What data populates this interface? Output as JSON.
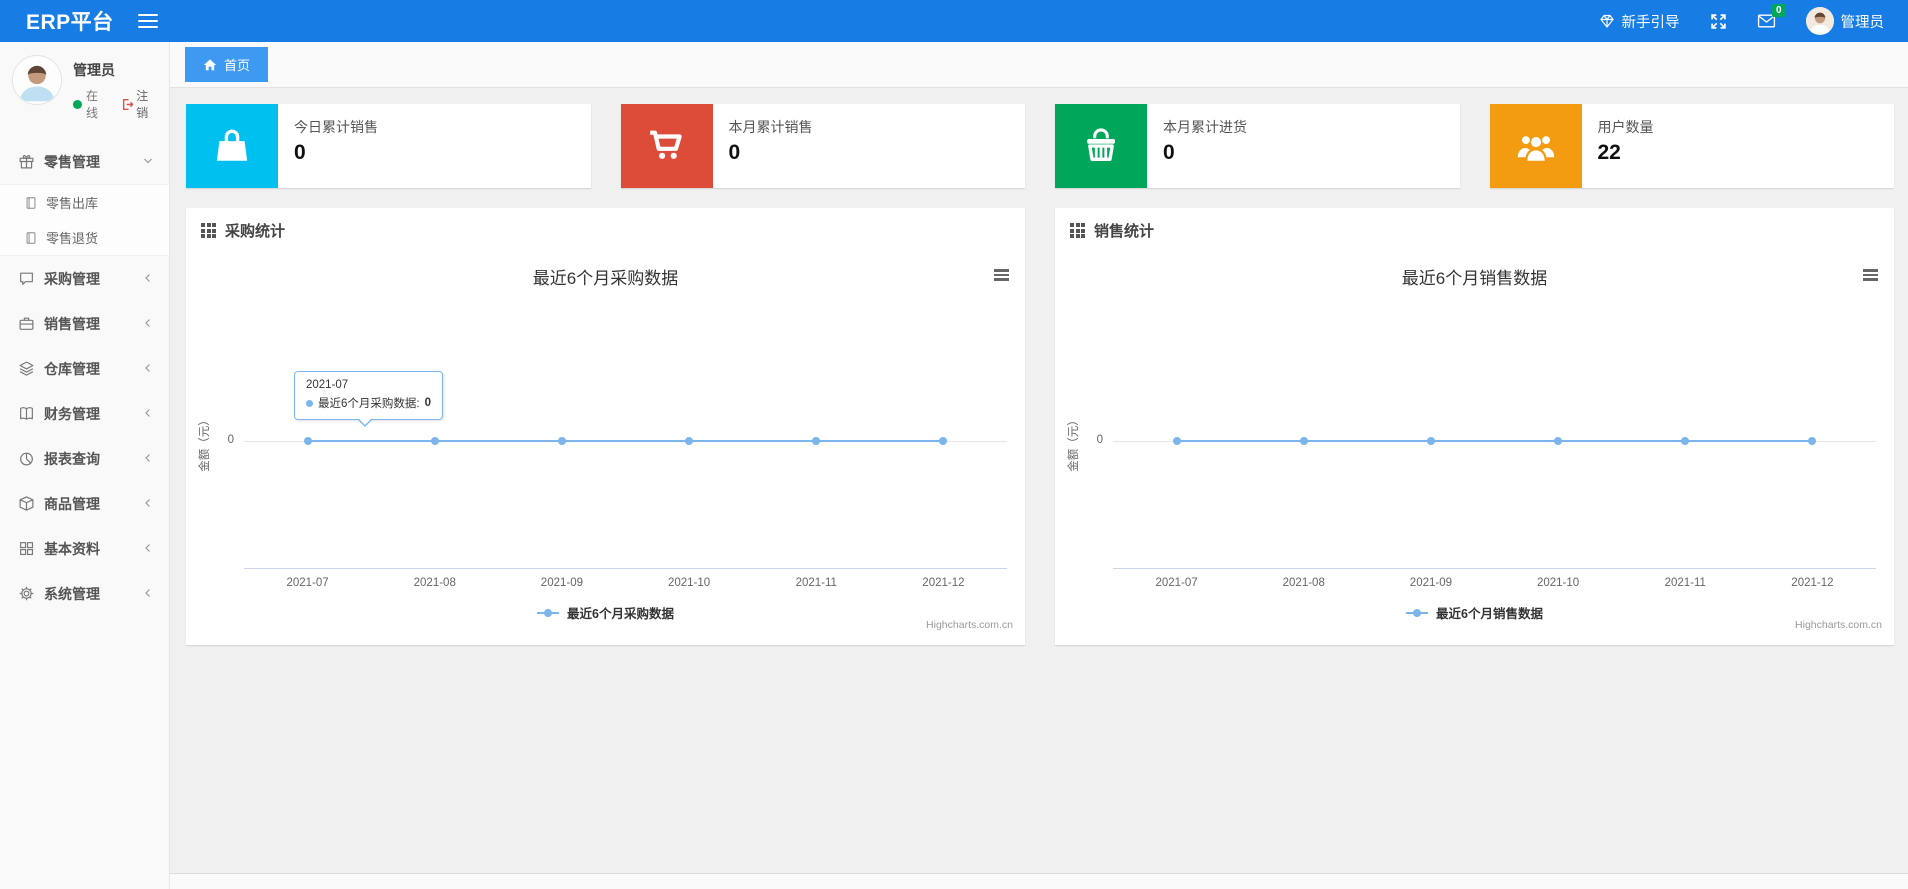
{
  "navbar": {
    "brand": "ERP平台",
    "guide_label": "新手引导",
    "messages_badge": "0",
    "user_name": "管理员"
  },
  "sidebar": {
    "user": {
      "name": "管理员",
      "status": "在线",
      "logout": "注销"
    },
    "menu": [
      {
        "label": "零售管理",
        "icon": "gift-icon",
        "state": "expanded",
        "children": [
          {
            "label": "零售出库",
            "icon": "journal-icon"
          },
          {
            "label": "零售退货",
            "icon": "journal-icon"
          }
        ]
      },
      {
        "label": "采购管理",
        "icon": "chat-icon",
        "state": "collapsed"
      },
      {
        "label": "销售管理",
        "icon": "briefcase-icon",
        "state": "collapsed"
      },
      {
        "label": "仓库管理",
        "icon": "layers-icon",
        "state": "collapsed"
      },
      {
        "label": "财务管理",
        "icon": "book-icon",
        "state": "collapsed"
      },
      {
        "label": "报表查询",
        "icon": "pie-chart-icon",
        "state": "collapsed"
      },
      {
        "label": "商品管理",
        "icon": "package-icon",
        "state": "collapsed"
      },
      {
        "label": "基本资料",
        "icon": "grid-icon",
        "state": "collapsed"
      },
      {
        "label": "系统管理",
        "icon": "gear-icon",
        "state": "collapsed"
      }
    ]
  },
  "tabs": [
    {
      "label": "首页",
      "active": true,
      "icon": "home-icon"
    }
  ],
  "stat_cards": [
    {
      "label": "今日累计销售",
      "value": "0",
      "color": "#00c0ef",
      "icon": "shopping-bag-icon"
    },
    {
      "label": "本月累计销售",
      "value": "0",
      "color": "#dd4b39",
      "icon": "shopping-cart-icon"
    },
    {
      "label": "本月累计进货",
      "value": "0",
      "color": "#00a65a",
      "icon": "shopping-basket-icon"
    },
    {
      "label": "用户数量",
      "value": "22",
      "color": "#f39c12",
      "icon": "users-icon"
    }
  ],
  "panels": [
    {
      "title": "采购统计"
    },
    {
      "title": "销售统计"
    }
  ],
  "chart_data": [
    {
      "type": "line",
      "title": "最近6个月采购数据",
      "x": [
        "2021-07",
        "2021-08",
        "2021-09",
        "2021-10",
        "2021-11",
        "2021-12"
      ],
      "series": [
        {
          "name": "最近6个月采购数据",
          "values": [
            0,
            0,
            0,
            0,
            0,
            0
          ],
          "color": "#7cb5ec"
        }
      ],
      "ylabel": "金额（元）",
      "yticks": [
        "0"
      ],
      "grid": true,
      "legend_position": "bottom",
      "credits": "Highcharts.com.cn",
      "tooltip": {
        "header": "2021-07",
        "series_label": "最近6个月采购数据:",
        "value": "0"
      }
    },
    {
      "type": "line",
      "title": "最近6个月销售数据",
      "x": [
        "2021-07",
        "2021-08",
        "2021-09",
        "2021-10",
        "2021-11",
        "2021-12"
      ],
      "series": [
        {
          "name": "最近6个月销售数据",
          "values": [
            0,
            0,
            0,
            0,
            0,
            0
          ],
          "color": "#7cb5ec"
        }
      ],
      "ylabel": "金额（元）",
      "yticks": [
        "0"
      ],
      "grid": true,
      "legend_position": "bottom",
      "credits": "Highcharts.com.cn"
    }
  ]
}
